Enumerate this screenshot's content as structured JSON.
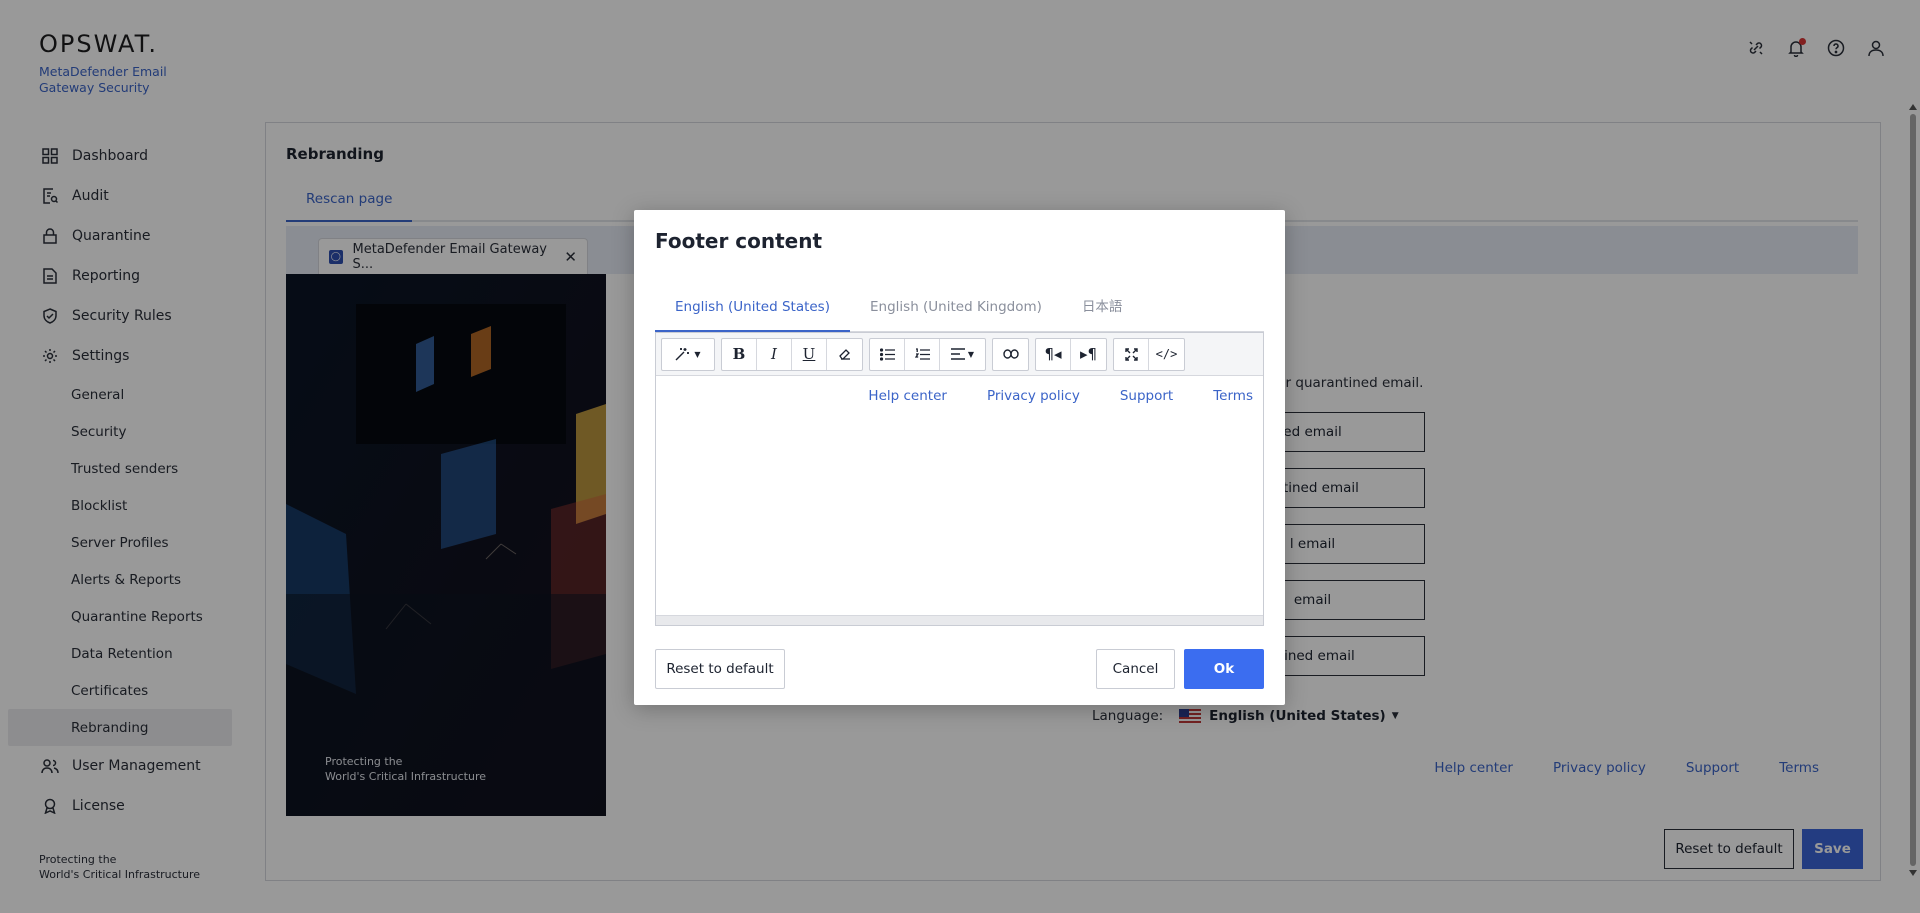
{
  "app": {
    "logo_text": "OPSWAT.",
    "product_name": "MetaDefender Email Gateway Security",
    "top_icons": [
      "unlink-icon",
      "bell-icon",
      "help-icon",
      "user-icon"
    ]
  },
  "sidebar": {
    "items": [
      {
        "label": "Dashboard",
        "icon": "grid-icon"
      },
      {
        "label": "Audit",
        "icon": "audit-icon"
      },
      {
        "label": "Quarantine",
        "icon": "lock-icon"
      },
      {
        "label": "Reporting",
        "icon": "document-icon"
      },
      {
        "label": "Security Rules",
        "icon": "shield-check-icon"
      },
      {
        "label": "Settings",
        "icon": "gear-icon"
      }
    ],
    "settings_subitems": [
      "General",
      "Security",
      "Trusted senders",
      "Blocklist",
      "Server Profiles",
      "Alerts & Reports",
      "Quarantine Reports",
      "Data Retention",
      "Certificates",
      "Rebranding"
    ],
    "bottom_items": [
      {
        "label": "User Management",
        "icon": "users-icon"
      },
      {
        "label": "License",
        "icon": "license-icon"
      }
    ],
    "footer_line1": "Protecting the",
    "footer_line2": "World's Critical Infrastructure"
  },
  "page": {
    "title": "Rebranding",
    "tab": "Rescan page",
    "browser_tab_title": "MetaDefender Email Gateway S...",
    "hero_caption_line1": "Protecting the",
    "hero_caption_line2": "World's Critical Infrastructure",
    "partial_text": "ur quarantined email.",
    "partial_buttons": [
      "ed email",
      "antined email",
      "l email",
      "email",
      "ntined email"
    ],
    "language_label": "Language:",
    "language_value": "English (United States)",
    "footer_links": [
      "Help center",
      "Privacy policy",
      "Support",
      "Terms"
    ],
    "reset_label": "Reset to default",
    "save_label": "Save"
  },
  "modal": {
    "title": "Footer content",
    "language_tabs": [
      "English (United States)",
      "English (United Kingdom)",
      "日本語"
    ],
    "active_tab_index": 0,
    "editor_links": [
      "Help center",
      "Privacy policy",
      "Support",
      "Terms"
    ],
    "reset_label": "Reset to default",
    "cancel_label": "Cancel",
    "ok_label": "Ok"
  },
  "colors": {
    "accent": "#3b64c8",
    "ok_button": "#3b6df0",
    "save_button": "#3b64d8"
  }
}
